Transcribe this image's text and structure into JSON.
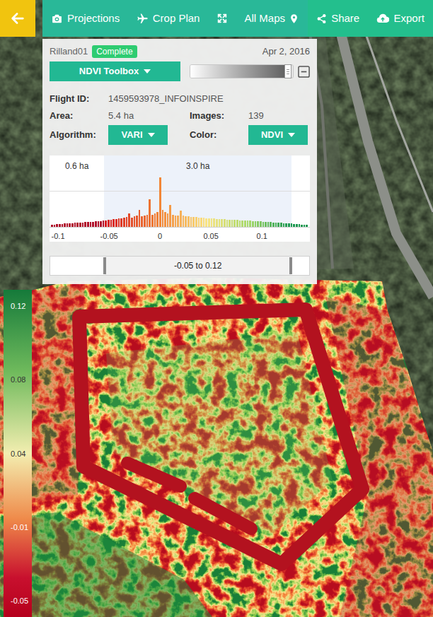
{
  "toolbar": {
    "items": [
      "Projections",
      "Crop Plan",
      "All Maps"
    ],
    "share": "Share",
    "export": "Export"
  },
  "panel": {
    "name": "Rilland01",
    "status": "Complete",
    "date": "Apr 2, 2016",
    "toolbox": "NDVI Toolbox",
    "opacity": {
      "level": 0.95
    }
  },
  "info": {
    "flight_id": {
      "label": "Flight ID:",
      "value": "1459593978_INFOINSPIRE"
    },
    "area": {
      "label": "Area:",
      "value": "5.4 ha"
    },
    "images": {
      "label": "Images:",
      "value": "139"
    },
    "algorithm": {
      "label": "Algorithm:",
      "value": "VARI"
    },
    "color": {
      "label": "Color:",
      "value": "NDVI"
    }
  },
  "histogram": {
    "below_area": "0.6 ha",
    "range_area": "3.0 ha",
    "ticks": [
      "-0.1",
      "-0.05",
      "0",
      "0.05",
      "0.1"
    ],
    "values": [
      3,
      3,
      4,
      4,
      4,
      5,
      5,
      5,
      5,
      6,
      6,
      6,
      6,
      7,
      7,
      7,
      7,
      8,
      8,
      8,
      9,
      9,
      10,
      10,
      11,
      11,
      12,
      12,
      13,
      14,
      20,
      13,
      15,
      16,
      25,
      15,
      17,
      18,
      40,
      18,
      20,
      22,
      72,
      25,
      22,
      20,
      32,
      18,
      17,
      16,
      24,
      16,
      15,
      15,
      14,
      14,
      14,
      13,
      13,
      13,
      12,
      12,
      12,
      12,
      11,
      11,
      11,
      11,
      10,
      10,
      10,
      10,
      10,
      9,
      9,
      9,
      9,
      9,
      8,
      8,
      8,
      8,
      7,
      7,
      7,
      7,
      6,
      6,
      6,
      6,
      5,
      5,
      5,
      5,
      4,
      4,
      4,
      3,
      3,
      3
    ]
  },
  "range": {
    "label": "-0.05 to 0.12",
    "low": 0.21,
    "high": 0.93
  },
  "legend": {
    "labels": [
      "0.12",
      "0.08",
      "0.04",
      "-0.01",
      "-0.05"
    ]
  }
}
